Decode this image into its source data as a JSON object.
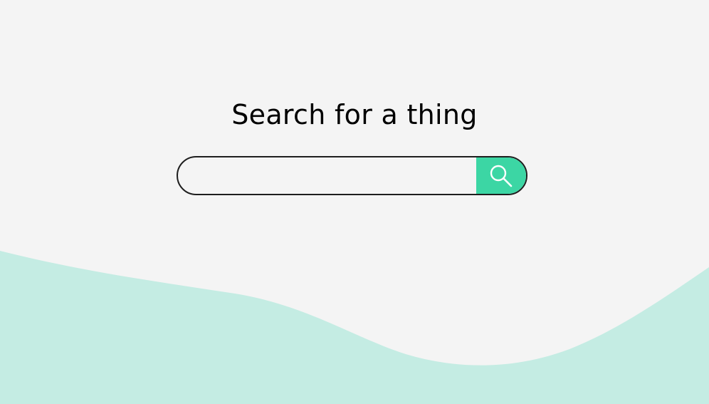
{
  "page": {
    "heading": "Search for a thing",
    "background_color": "#f4f4f4",
    "wave_color": "#c4ece3"
  },
  "search": {
    "value": "",
    "placeholder": "",
    "button_color": "#3cd6a4",
    "button_icon": "search-icon"
  }
}
